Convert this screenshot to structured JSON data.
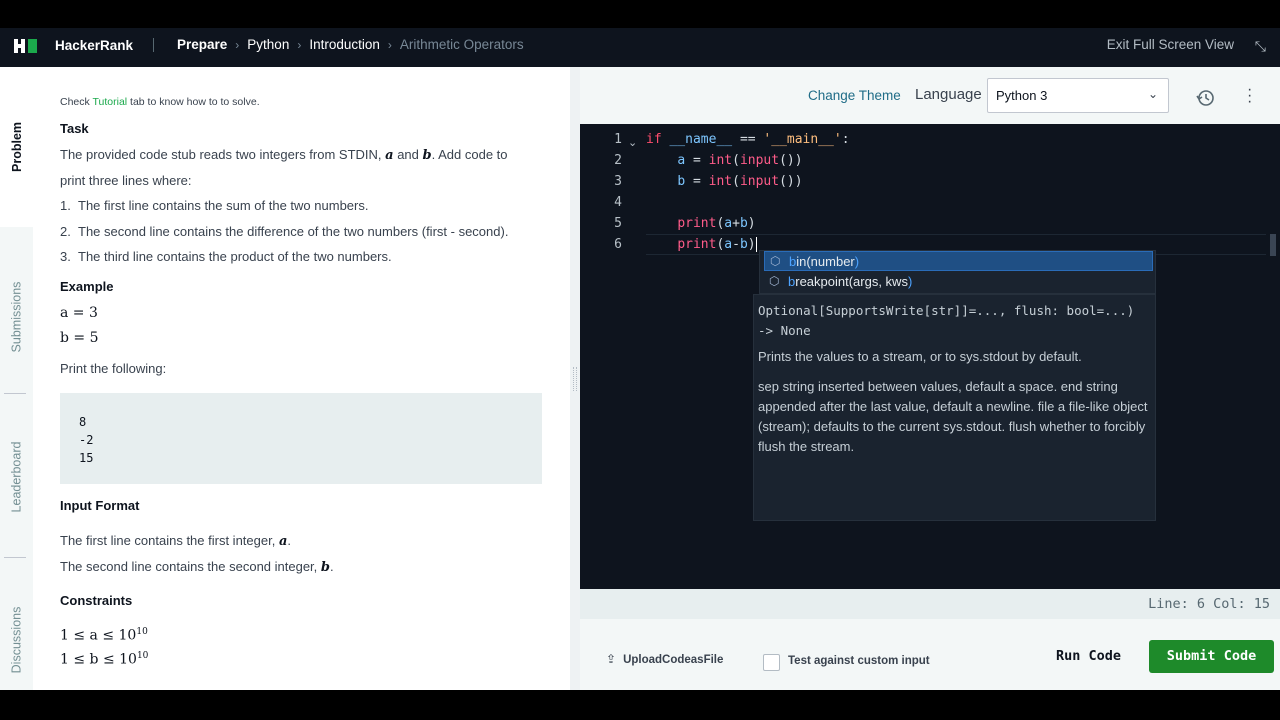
{
  "navbar": {
    "brand": "HackerRank",
    "crumbs": [
      "Prepare",
      "Python",
      "Introduction",
      "Arithmetic Operators"
    ],
    "exit_fullscreen": "Exit Full Screen View"
  },
  "vtabs": [
    "Problem",
    "Submissions",
    "Leaderboard",
    "Discussions"
  ],
  "problem": {
    "tip_prefix": "Check ",
    "tip_link": "Tutorial",
    "tip_suffix": " tab to know how to to solve.",
    "task_heading": "Task",
    "task_line1_a": "The provided code stub reads two integers from STDIN, ",
    "var_a": "a",
    "and": " and ",
    "var_b": "b",
    "task_line1_b": ". Add code to",
    "task_line2": "print three lines where:",
    "list": [
      {
        "num": "1.",
        "text": "The first line contains the sum of the two numbers."
      },
      {
        "num": "2.",
        "text": "The second line contains the difference of the two numbers (first - second)."
      },
      {
        "num": "3.",
        "text": "The third line contains the product of the two numbers."
      }
    ],
    "example_heading": "Example",
    "ex_a": "a = 3",
    "ex_b": "b = 5",
    "print_following": "Print the following:",
    "output": [
      "8",
      "-2",
      "15"
    ],
    "input_heading": "Input Format",
    "input_line1": "The first line contains the first integer, ",
    "input_line2": "The second line contains the second integer, ",
    "period": ".",
    "constraints_heading": "Constraints",
    "c1": "1 ≤ a ≤ 10",
    "c2": "1 ≤ b ≤ 10",
    "exp": "10"
  },
  "editor_header": {
    "change_theme": "Change Theme",
    "language_label": "Language",
    "language_value": "Python 3"
  },
  "code": {
    "line_numbers": [
      "1",
      "2",
      "3",
      "4",
      "5",
      "6"
    ],
    "lines": [
      "if __name__ == '__main__':",
      "    a = int(input())",
      "    b = int(input())",
      "",
      "    print(a+b)",
      "    print(a-b)"
    ]
  },
  "autocomplete": {
    "items": [
      {
        "match": "b",
        "rest": "in(number",
        "close": ")"
      },
      {
        "match": "b",
        "rest": "reakpoint(args, kws",
        "close": ")"
      }
    ],
    "signature": "Optional[SupportsWrite[str]]=..., flush: bool=...) -> None",
    "doc_line": "Prints the values to a stream, or to sys.stdout by default.",
    "doc_params": "sep   string inserted between values, default a space. end   string appended after the last value, default a newline. file   a file-like object (stream); defaults to the current sys.stdout. flush   whether to forcibly flush the stream."
  },
  "status": {
    "line_col": "Line: 6 Col: 15"
  },
  "actions": {
    "upload": "UploadCodeasFile",
    "custom_input": "Test against custom input",
    "run": "Run Code",
    "submit": "Submit Code"
  }
}
